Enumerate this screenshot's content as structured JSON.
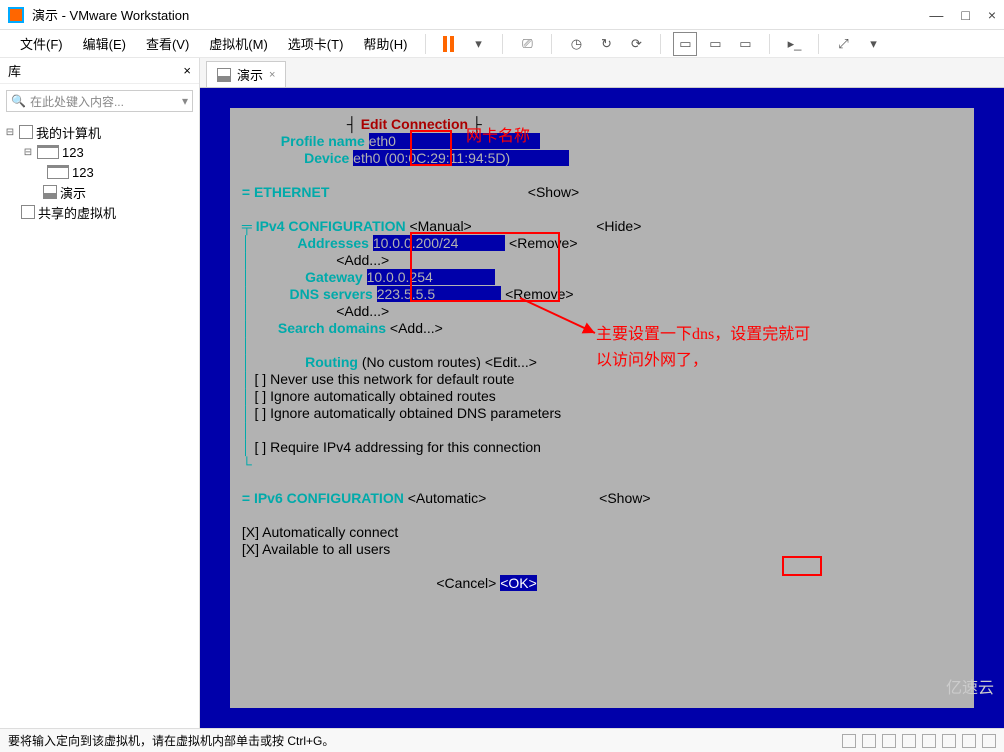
{
  "window": {
    "title": "演示 - VMware Workstation",
    "minimize": "—",
    "maximize": "□",
    "close": "×"
  },
  "menu": {
    "file": "文件(F)",
    "edit": "编辑(E)",
    "view": "查看(V)",
    "vm": "虚拟机(M)",
    "tabs": "选项卡(T)",
    "help": "帮助(H)"
  },
  "sidebar": {
    "title": "库",
    "close": "×",
    "search_placeholder": "在此处键入内容...",
    "tree": {
      "root": "我的计算机",
      "n1": "123",
      "n2": "123",
      "n3": "演示",
      "shared": "共享的虚拟机"
    }
  },
  "tab": {
    "label": "演示"
  },
  "terminal": {
    "title": "Edit Connection",
    "profile_label": "Profile name",
    "profile_value": "eth0",
    "device_label": "Device",
    "device_value": "eth0",
    "device_mac": "(00:0C:29:11:94:5D)",
    "eth_section": "= ETHERNET",
    "show": "<Show>",
    "hide": "<Hide>",
    "ipv4_label": "IPv4 CONFIGURATION",
    "ipv4_mode": "<Manual>",
    "addresses_label": "Addresses",
    "address_value": "10.0.0.200/24",
    "add": "<Add...>",
    "remove": "<Remove>",
    "gateway_label": "Gateway",
    "gateway_value": "10.0.0.254",
    "dns_label": "DNS servers",
    "dns_value": "223.5.5.5",
    "search_label": "Search domains",
    "routing_label": "Routing",
    "routing_value": "(No custom routes)",
    "edit": "<Edit...>",
    "cb1": "[ ] Never use this network for default route",
    "cb2": "[ ] Ignore automatically obtained routes",
    "cb3": "[ ] Ignore automatically obtained DNS parameters",
    "cb4": "[ ] Require IPv4 addressing for this connection",
    "ipv6_label": "= IPv6 CONFIGURATION",
    "ipv6_mode": "<Automatic>",
    "auto_connect": "[X] Automatically connect",
    "all_users": "[X] Available to all users",
    "cancel": "<Cancel>",
    "ok": "<OK>"
  },
  "annotations": {
    "a1": "网卡名称",
    "a2": "主要设置一下dns，设置完就可",
    "a3": "以访问外网了，"
  },
  "status": {
    "text": "要将输入定向到该虚拟机，请在虚拟机内部单击或按 Ctrl+G。"
  },
  "watermark": "亿速云"
}
